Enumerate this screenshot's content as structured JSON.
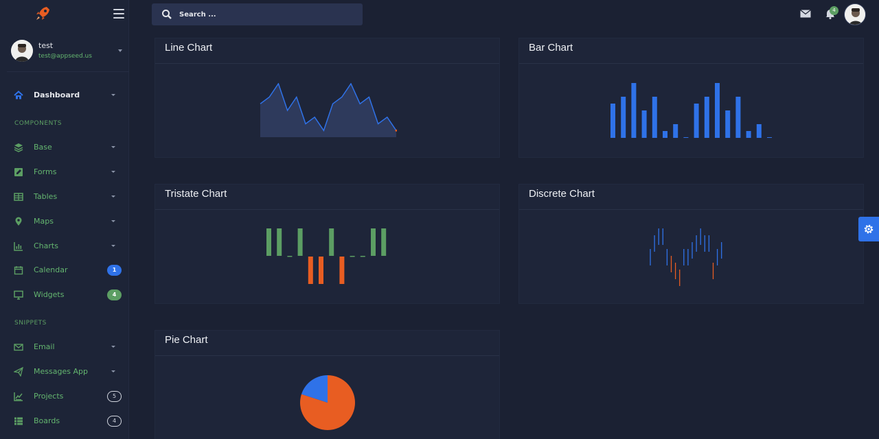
{
  "sidebar": {
    "user": {
      "name": "test",
      "email": "test@appseed.us"
    },
    "items": [
      {
        "label": "Dashboard",
        "icon": "home-icon",
        "active": true,
        "has_caret": true
      },
      {
        "label": "Base",
        "icon": "layers-icon",
        "has_caret": true
      },
      {
        "label": "Forms",
        "icon": "edit-icon",
        "has_caret": true
      },
      {
        "label": "Tables",
        "icon": "table-icon",
        "has_caret": true
      },
      {
        "label": "Maps",
        "icon": "map-pin-icon",
        "has_caret": true
      },
      {
        "label": "Charts",
        "icon": "bar-chart-icon",
        "has_caret": true
      },
      {
        "label": "Calendar",
        "icon": "calendar-icon",
        "badge": "1",
        "badge_style": "blue"
      },
      {
        "label": "Widgets",
        "icon": "monitor-icon",
        "badge": "4",
        "badge_style": "green"
      },
      {
        "label": "Email",
        "icon": "mail-icon",
        "has_caret": true
      },
      {
        "label": "Messages App",
        "icon": "send-icon",
        "has_caret": true
      },
      {
        "label": "Projects",
        "icon": "projects-icon",
        "badge": "5",
        "badge_style": "outline"
      },
      {
        "label": "Boards",
        "icon": "boards-icon",
        "badge": "4",
        "badge_style": "outline"
      }
    ],
    "sections": {
      "components": "COMPONENTS",
      "snippets": "SNIPPETS"
    }
  },
  "topbar": {
    "search_placeholder": "Search ...",
    "notification_count": "4"
  },
  "cards": {
    "line": {
      "title": "Line Chart"
    },
    "bar": {
      "title": "Bar Chart"
    },
    "tristate": {
      "title": "Tristate Chart"
    },
    "discrete": {
      "title": "Discrete Chart"
    },
    "pie": {
      "title": "Pie Chart"
    }
  },
  "colors": {
    "accent_blue": "#2f72e8",
    "accent_green": "#5c9e63",
    "accent_orange": "#e85d22",
    "sparkline_fill": "#2e3a5c"
  },
  "chart_data": [
    {
      "type": "line",
      "values": [
        5,
        6,
        8,
        4,
        6,
        2,
        3,
        1,
        5,
        6,
        8,
        5,
        6,
        2,
        3,
        1
      ]
    },
    {
      "type": "bar",
      "values": [
        5,
        6,
        8,
        4,
        6,
        1,
        2,
        0,
        5,
        6,
        8,
        4,
        6,
        1,
        2,
        0
      ]
    },
    {
      "type": "bar",
      "name": "tristate",
      "values": [
        1,
        1,
        0,
        1,
        -1,
        -1,
        1,
        -1,
        0,
        0,
        1,
        1
      ]
    },
    {
      "type": "bar",
      "name": "discrete",
      "values": [
        4,
        6,
        7,
        7,
        4,
        3,
        2,
        1,
        4,
        4,
        5,
        6,
        7,
        6,
        6,
        2,
        4,
        5
      ]
    },
    {
      "type": "pie",
      "values": [
        4,
        1
      ]
    }
  ]
}
